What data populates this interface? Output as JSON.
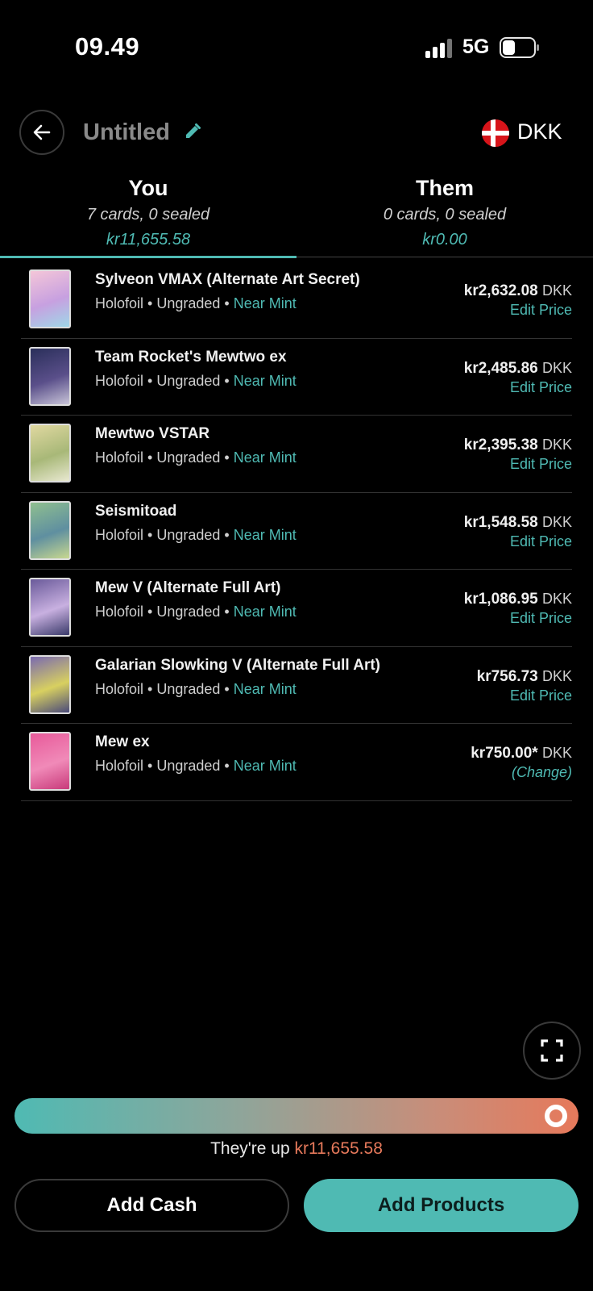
{
  "status_bar": {
    "time": "09.49",
    "network": "5G",
    "battery_level": 0.35
  },
  "header": {
    "title": "Untitled",
    "currency": "DKK"
  },
  "tabs": [
    {
      "name": "You",
      "summary": "7 cards, 0 sealed",
      "total": "kr11,655.58"
    },
    {
      "name": "Them",
      "summary": "0 cards, 0 sealed",
      "total": "kr0.00"
    }
  ],
  "cards": [
    {
      "name": "Sylveon VMAX (Alternate Art Secret)",
      "finish": "Holofoil",
      "grade": "Ungraded",
      "condition": "Near Mint",
      "price": "kr2,632.08",
      "currency": "DKK",
      "action": "Edit Price",
      "thumb_colors": [
        "#f4c6d8",
        "#c7a0e0",
        "#9fd7e8"
      ]
    },
    {
      "name": "Team Rocket's Mewtwo ex",
      "finish": "Holofoil",
      "grade": "Ungraded",
      "condition": "Near Mint",
      "price": "kr2,485.86",
      "currency": "DKK",
      "action": "Edit Price",
      "thumb_colors": [
        "#2a2f5a",
        "#5a4f8a",
        "#c8c4d8"
      ]
    },
    {
      "name": "Mewtwo VSTAR",
      "finish": "Holofoil",
      "grade": "Ungraded",
      "condition": "Near Mint",
      "price": "kr2,395.38",
      "currency": "DKK",
      "action": "Edit Price",
      "thumb_colors": [
        "#e0d8a0",
        "#a8b878",
        "#e8e8d0"
      ]
    },
    {
      "name": "Seismitoad",
      "finish": "Holofoil",
      "grade": "Ungraded",
      "condition": "Near Mint",
      "price": "kr1,548.58",
      "currency": "DKK",
      "action": "Edit Price",
      "thumb_colors": [
        "#8fbf8f",
        "#5f8fa0",
        "#c8d890"
      ]
    },
    {
      "name": "Mew V (Alternate Full Art)",
      "finish": "Holofoil",
      "grade": "Ungraded",
      "condition": "Near Mint",
      "price": "kr1,086.95",
      "currency": "DKK",
      "action": "Edit Price",
      "thumb_colors": [
        "#6a5a9a",
        "#c8b0e0",
        "#3a3a6a"
      ]
    },
    {
      "name": "Galarian Slowking V (Alternate Full Art)",
      "finish": "Holofoil",
      "grade": "Ungraded",
      "condition": "Near Mint",
      "price": "kr756.73",
      "currency": "DKK",
      "action": "Edit Price",
      "thumb_colors": [
        "#7a6ab0",
        "#d8d060",
        "#4a4a7a"
      ]
    },
    {
      "name": "Mew ex",
      "finish": "Holofoil",
      "grade": "Ungraded",
      "condition": "Near Mint",
      "price": "kr750.00*",
      "currency": "DKK",
      "action": "(Change)",
      "thumb_colors": [
        "#e85a9a",
        "#f08ab8",
        "#c83a7a"
      ]
    }
  ],
  "balance": {
    "prefix": "They're up ",
    "amount": "kr11,655.58",
    "position": 0.98
  },
  "buttons": {
    "add_cash": "Add Cash",
    "add_products": "Add Products"
  },
  "colors": {
    "accent": "#4fbab3",
    "warning": "#e6795b",
    "background": "#000000"
  },
  "icons": {
    "back": "arrow-left-icon",
    "edit": "pencil-icon",
    "flag": "denmark-flag-icon",
    "fullscreen": "expand-icon"
  }
}
